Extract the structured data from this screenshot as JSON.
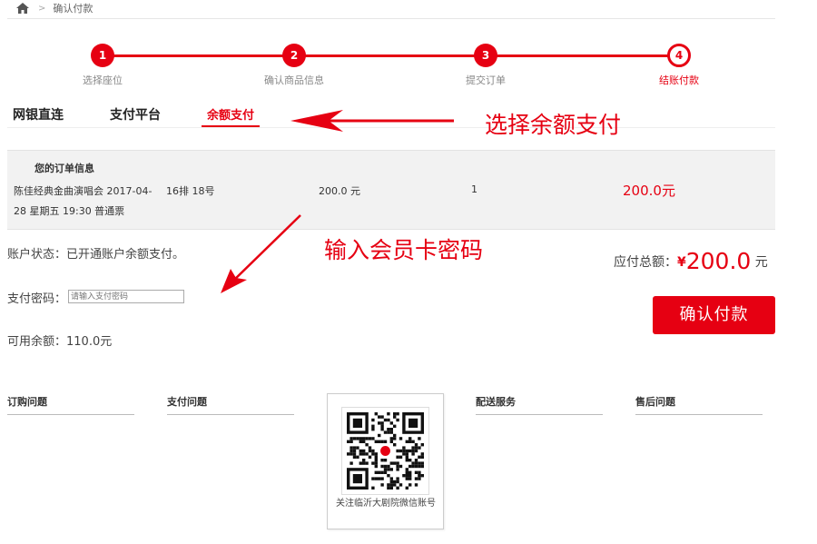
{
  "breadcrumb": {
    "current": "确认付款"
  },
  "steps": [
    {
      "num": "1",
      "label": "选择座位"
    },
    {
      "num": "2",
      "label": "确认商品信息"
    },
    {
      "num": "3",
      "label": "提交订单"
    },
    {
      "num": "4",
      "label": "结账付款"
    }
  ],
  "tabs": [
    {
      "label": "网银直连"
    },
    {
      "label": "支付平台"
    },
    {
      "label": "余额支付"
    }
  ],
  "annotations": {
    "select_balance": "选择余额支付",
    "enter_password": "输入会员卡密码"
  },
  "order": {
    "title": "您的订单信息",
    "item_line1": "陈佳经典金曲演唱会 2017-04-",
    "item_line2": "28 星期五 19:30 普通票",
    "seat": "16排 18号",
    "price": "200.0 元",
    "qty": "1",
    "subtotal": "200.0元"
  },
  "account": {
    "status": "账户状态：已开通账户余额支付。",
    "password_label": "支付密码：",
    "password_placeholder": "请输入支付密码",
    "balance": "可用余额：110.0元"
  },
  "total": {
    "label": "应付总额：",
    "currency": "¥",
    "amount": "200.0",
    "unit": "元"
  },
  "pay_button": "确认付款",
  "footer": {
    "cols": [
      "订购问题",
      "支付问题",
      "配送服务",
      "售后问题"
    ],
    "qr_caption": "关注临沂大剧院微信账号"
  },
  "colors": {
    "accent": "#e60012"
  }
}
